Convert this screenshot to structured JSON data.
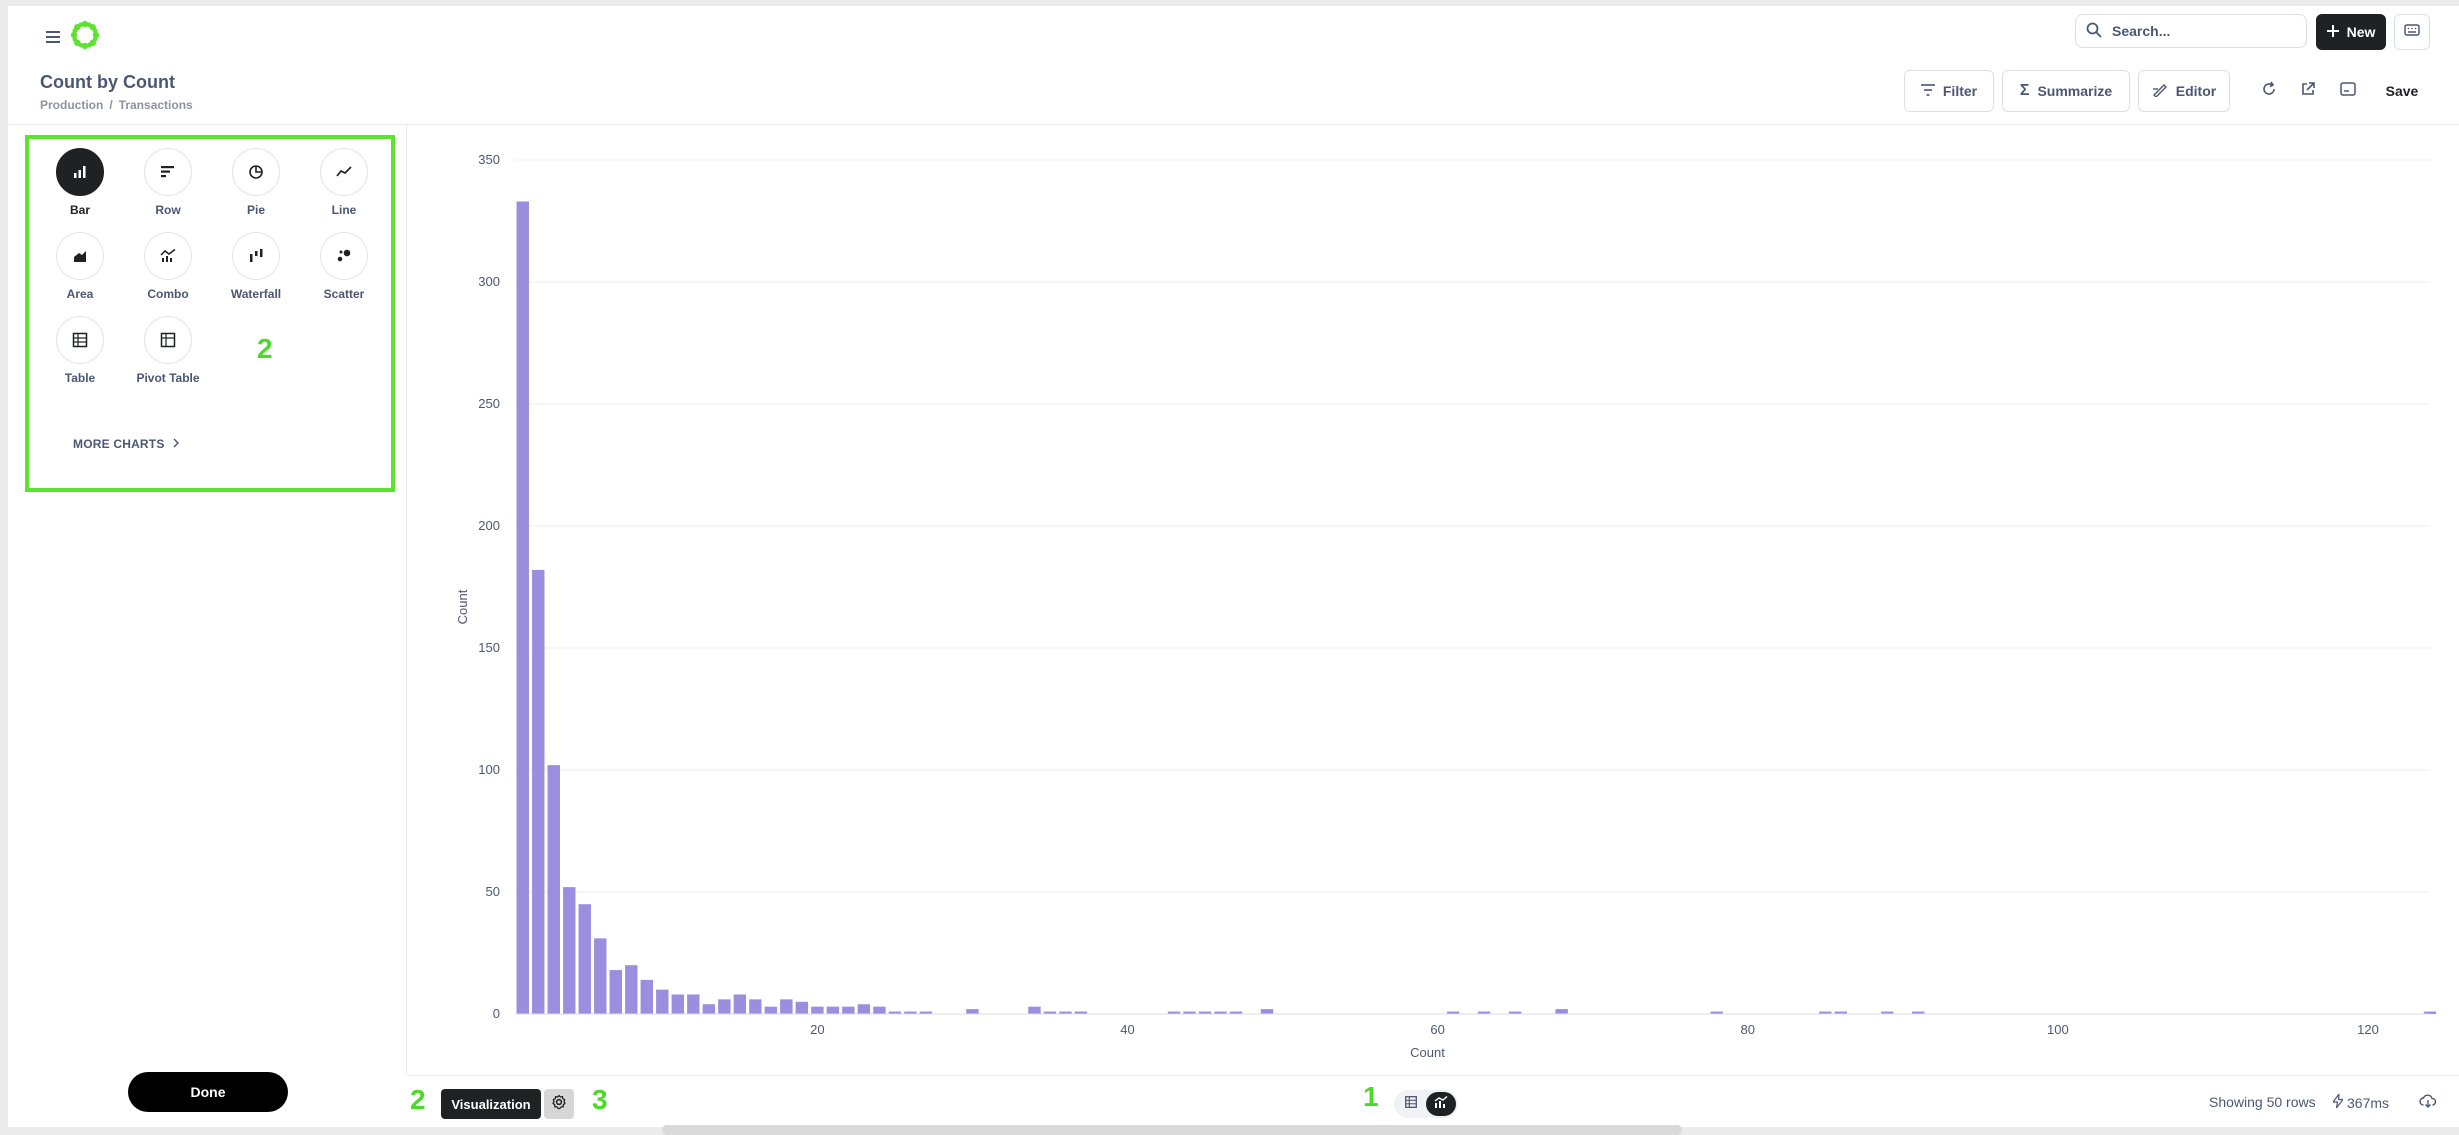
{
  "app": {
    "brand_color": "#5ce32f",
    "search_placeholder": "Search...",
    "new_label": "New"
  },
  "question": {
    "title": "Count by Count",
    "breadcrumb": [
      "Production",
      "/",
      "Transactions"
    ]
  },
  "toolbar": {
    "filter_label": "Filter",
    "summarize_label": "Summarize",
    "editor_label": "Editor",
    "save_label": "Save",
    "icons": [
      "refresh-icon",
      "open-external-icon",
      "embed-icon"
    ]
  },
  "chart_types": [
    {
      "label": "Bar",
      "icon": "bar-chart-icon",
      "selected": true
    },
    {
      "label": "Row",
      "icon": "row-chart-icon",
      "selected": false
    },
    {
      "label": "Pie",
      "icon": "pie-chart-icon",
      "selected": false
    },
    {
      "label": "Line",
      "icon": "line-chart-icon",
      "selected": false
    },
    {
      "label": "Area",
      "icon": "area-chart-icon",
      "selected": false
    },
    {
      "label": "Combo",
      "icon": "combo-chart-icon",
      "selected": false
    },
    {
      "label": "Waterfall",
      "icon": "waterfall-chart-icon",
      "selected": false
    },
    {
      "label": "Scatter",
      "icon": "scatter-chart-icon",
      "selected": false
    },
    {
      "label": "Table",
      "icon": "table-icon",
      "selected": false
    },
    {
      "label": "Pivot Table",
      "icon": "pivot-table-icon",
      "selected": false
    }
  ],
  "sidebar": {
    "more_charts_label": "MORE CHARTS",
    "done_label": "Done"
  },
  "annotations": {
    "sidebar_marker": "2",
    "footer_left_marker": "2",
    "footer_gear_marker": "3",
    "footer_toggle_marker": "1",
    "color": "#4fd82c"
  },
  "footer": {
    "visualization_label": "Visualization",
    "row_count": "Showing 50 rows",
    "timing": "367ms"
  },
  "chart_data": {
    "type": "bar",
    "title": "",
    "xlabel": "Count",
    "ylabel": "Count",
    "xlim": [
      0.5,
      124
    ],
    "ylim": [
      0,
      350
    ],
    "xticks": [
      20,
      40,
      60,
      80,
      100,
      120
    ],
    "yticks": [
      0,
      50,
      100,
      150,
      200,
      250,
      300,
      350
    ],
    "grid": true,
    "bar_color": "#9a8edf",
    "x": [
      1,
      2,
      3,
      4,
      5,
      6,
      7,
      8,
      9,
      10,
      11,
      12,
      13,
      14,
      15,
      16,
      17,
      18,
      19,
      20,
      21,
      22,
      23,
      24,
      25,
      26,
      27,
      30,
      34,
      35,
      36,
      37,
      43,
      44,
      45,
      46,
      47,
      49,
      61,
      63,
      65,
      68,
      78,
      85,
      86,
      89,
      91,
      124
    ],
    "values": [
      333,
      182,
      102,
      52,
      45,
      31,
      18,
      20,
      14,
      10,
      8,
      8,
      4,
      6,
      8,
      6,
      3,
      6,
      5,
      3,
      3,
      3,
      4,
      3,
      1,
      1,
      1,
      2,
      3,
      1,
      1,
      1,
      1,
      1,
      1,
      1,
      1,
      2,
      1,
      1,
      1,
      2,
      1,
      1,
      1,
      1,
      1,
      1
    ]
  }
}
